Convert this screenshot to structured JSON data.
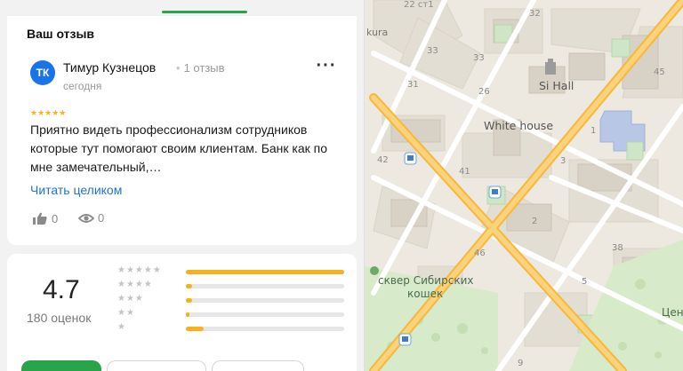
{
  "review_section": {
    "title": "Ваш отзыв",
    "author": {
      "initials": "ТК",
      "name": "Тимур Кузнецов",
      "review_count": "1 отзыв",
      "date": "сегодня"
    },
    "stars": 5,
    "stars_text": "★★★★★",
    "text": "Приятно видеть профессионализм сотрудников которые тут помогают своим клиентам. Банк как по мне замечательный,…",
    "read_more": "Читать целиком",
    "likes": "0",
    "views": "0",
    "more_icon": "more-icon",
    "like_icon": "thumb-up-icon",
    "view_icon": "eye-icon",
    "colors": {
      "accent": "#2aa44a",
      "avatar": "#1b73e8",
      "star": "#f5b21b",
      "link": "#1e73d6"
    }
  },
  "rating_summary": {
    "average": "4.7",
    "count_text": "180 оценок",
    "distribution": [
      {
        "stars": "★★★★★",
        "fraction": 1.0
      },
      {
        "stars": "★★★★",
        "fraction": 0.04
      },
      {
        "stars": "★★★",
        "fraction": 0.04
      },
      {
        "stars": "★★",
        "fraction": 0.02
      },
      {
        "stars": "★",
        "fraction": 0.11
      }
    ]
  },
  "map": {
    "places": [
      "Si Hall",
      "White house",
      "сквер Сибирских кошек",
      "Цен п"
    ],
    "park_line1": "сквер Сибирских",
    "park_line2": "кошек",
    "street_fragment": "kura",
    "house_numbers": [
      "22 ст1",
      "32",
      "33",
      "33",
      "31",
      "26",
      "45",
      "42",
      "41",
      "3",
      "1",
      "46",
      "38",
      "2",
      "5",
      "9"
    ]
  }
}
